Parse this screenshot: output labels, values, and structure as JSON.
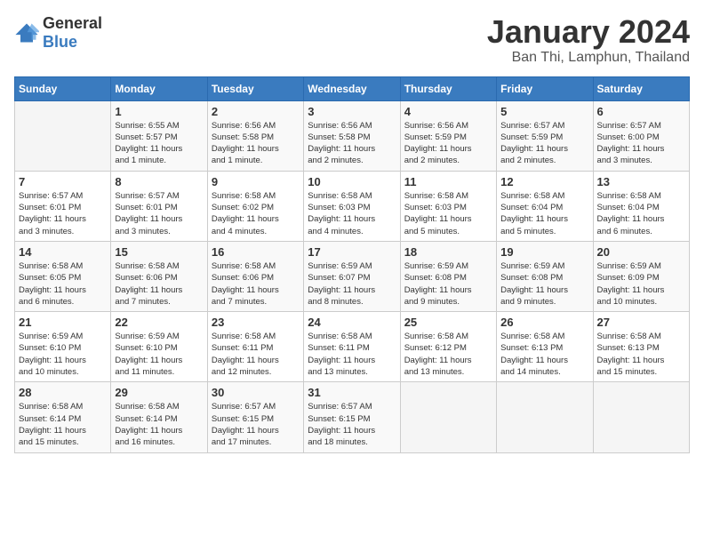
{
  "logo": {
    "general": "General",
    "blue": "Blue"
  },
  "header": {
    "month": "January 2024",
    "location": "Ban Thi, Lamphun, Thailand"
  },
  "days_of_week": [
    "Sunday",
    "Monday",
    "Tuesday",
    "Wednesday",
    "Thursday",
    "Friday",
    "Saturday"
  ],
  "weeks": [
    [
      {
        "day": "",
        "info": ""
      },
      {
        "day": "1",
        "info": "Sunrise: 6:55 AM\nSunset: 5:57 PM\nDaylight: 11 hours\nand 1 minute."
      },
      {
        "day": "2",
        "info": "Sunrise: 6:56 AM\nSunset: 5:58 PM\nDaylight: 11 hours\nand 1 minute."
      },
      {
        "day": "3",
        "info": "Sunrise: 6:56 AM\nSunset: 5:58 PM\nDaylight: 11 hours\nand 2 minutes."
      },
      {
        "day": "4",
        "info": "Sunrise: 6:56 AM\nSunset: 5:59 PM\nDaylight: 11 hours\nand 2 minutes."
      },
      {
        "day": "5",
        "info": "Sunrise: 6:57 AM\nSunset: 5:59 PM\nDaylight: 11 hours\nand 2 minutes."
      },
      {
        "day": "6",
        "info": "Sunrise: 6:57 AM\nSunset: 6:00 PM\nDaylight: 11 hours\nand 3 minutes."
      }
    ],
    [
      {
        "day": "7",
        "info": "Sunrise: 6:57 AM\nSunset: 6:01 PM\nDaylight: 11 hours\nand 3 minutes."
      },
      {
        "day": "8",
        "info": "Sunrise: 6:57 AM\nSunset: 6:01 PM\nDaylight: 11 hours\nand 3 minutes."
      },
      {
        "day": "9",
        "info": "Sunrise: 6:58 AM\nSunset: 6:02 PM\nDaylight: 11 hours\nand 4 minutes."
      },
      {
        "day": "10",
        "info": "Sunrise: 6:58 AM\nSunset: 6:03 PM\nDaylight: 11 hours\nand 4 minutes."
      },
      {
        "day": "11",
        "info": "Sunrise: 6:58 AM\nSunset: 6:03 PM\nDaylight: 11 hours\nand 5 minutes."
      },
      {
        "day": "12",
        "info": "Sunrise: 6:58 AM\nSunset: 6:04 PM\nDaylight: 11 hours\nand 5 minutes."
      },
      {
        "day": "13",
        "info": "Sunrise: 6:58 AM\nSunset: 6:04 PM\nDaylight: 11 hours\nand 6 minutes."
      }
    ],
    [
      {
        "day": "14",
        "info": "Sunrise: 6:58 AM\nSunset: 6:05 PM\nDaylight: 11 hours\nand 6 minutes."
      },
      {
        "day": "15",
        "info": "Sunrise: 6:58 AM\nSunset: 6:06 PM\nDaylight: 11 hours\nand 7 minutes."
      },
      {
        "day": "16",
        "info": "Sunrise: 6:58 AM\nSunset: 6:06 PM\nDaylight: 11 hours\nand 7 minutes."
      },
      {
        "day": "17",
        "info": "Sunrise: 6:59 AM\nSunset: 6:07 PM\nDaylight: 11 hours\nand 8 minutes."
      },
      {
        "day": "18",
        "info": "Sunrise: 6:59 AM\nSunset: 6:08 PM\nDaylight: 11 hours\nand 9 minutes."
      },
      {
        "day": "19",
        "info": "Sunrise: 6:59 AM\nSunset: 6:08 PM\nDaylight: 11 hours\nand 9 minutes."
      },
      {
        "day": "20",
        "info": "Sunrise: 6:59 AM\nSunset: 6:09 PM\nDaylight: 11 hours\nand 10 minutes."
      }
    ],
    [
      {
        "day": "21",
        "info": "Sunrise: 6:59 AM\nSunset: 6:10 PM\nDaylight: 11 hours\nand 10 minutes."
      },
      {
        "day": "22",
        "info": "Sunrise: 6:59 AM\nSunset: 6:10 PM\nDaylight: 11 hours\nand 11 minutes."
      },
      {
        "day": "23",
        "info": "Sunrise: 6:58 AM\nSunset: 6:11 PM\nDaylight: 11 hours\nand 12 minutes."
      },
      {
        "day": "24",
        "info": "Sunrise: 6:58 AM\nSunset: 6:11 PM\nDaylight: 11 hours\nand 13 minutes."
      },
      {
        "day": "25",
        "info": "Sunrise: 6:58 AM\nSunset: 6:12 PM\nDaylight: 11 hours\nand 13 minutes."
      },
      {
        "day": "26",
        "info": "Sunrise: 6:58 AM\nSunset: 6:13 PM\nDaylight: 11 hours\nand 14 minutes."
      },
      {
        "day": "27",
        "info": "Sunrise: 6:58 AM\nSunset: 6:13 PM\nDaylight: 11 hours\nand 15 minutes."
      }
    ],
    [
      {
        "day": "28",
        "info": "Sunrise: 6:58 AM\nSunset: 6:14 PM\nDaylight: 11 hours\nand 15 minutes."
      },
      {
        "day": "29",
        "info": "Sunrise: 6:58 AM\nSunset: 6:14 PM\nDaylight: 11 hours\nand 16 minutes."
      },
      {
        "day": "30",
        "info": "Sunrise: 6:57 AM\nSunset: 6:15 PM\nDaylight: 11 hours\nand 17 minutes."
      },
      {
        "day": "31",
        "info": "Sunrise: 6:57 AM\nSunset: 6:15 PM\nDaylight: 11 hours\nand 18 minutes."
      },
      {
        "day": "",
        "info": ""
      },
      {
        "day": "",
        "info": ""
      },
      {
        "day": "",
        "info": ""
      }
    ]
  ]
}
